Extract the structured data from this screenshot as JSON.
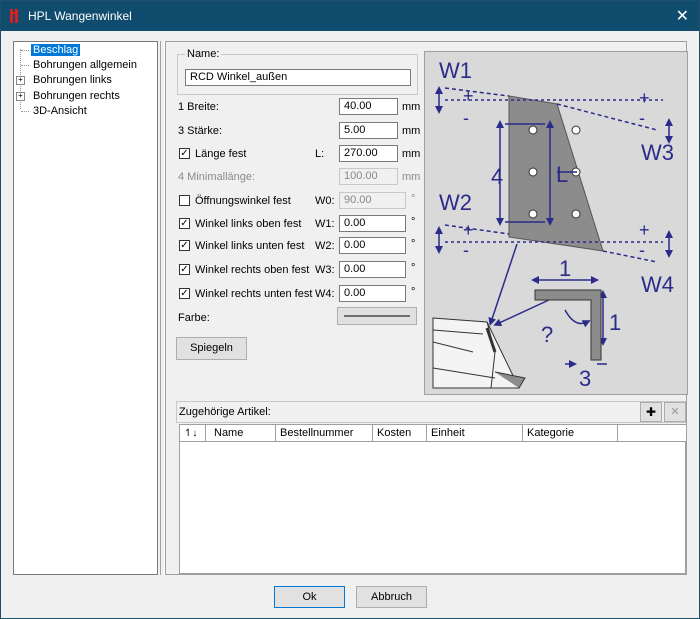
{
  "window": {
    "title": "HPL Wangenwinkel",
    "close_glyph": "✕"
  },
  "tree": {
    "items": [
      {
        "label": "Beschlag"
      },
      {
        "label": "Bohrungen allgemein"
      },
      {
        "label": "Bohrungen links"
      },
      {
        "label": "Bohrungen rechts"
      },
      {
        "label": "3D-Ansicht"
      }
    ]
  },
  "form": {
    "name_group": "Name:",
    "name_value": "RCD Winkel_außen",
    "breite_label": "1 Breite:",
    "breite_value": "40.00",
    "staerke_label": "3 Stärke:",
    "staerke_value": "5.00",
    "laenge_fest_label": "Länge fest",
    "laenge_fest_checked": true,
    "l_label": "L:",
    "l_value": "270.00",
    "minimallaenge_label": "4 Minimallänge:",
    "minimallaenge_value": "100.00",
    "oeffnungswinkel_label": "Öffnungswinkel fest",
    "oeffnungswinkel_checked": false,
    "w0_label": "W0:",
    "w0_value": "90.00",
    "wlo_label": "Winkel links oben fest",
    "wlo_checked": true,
    "w1_label": "W1:",
    "w1_value": "0.00",
    "wlu_label": "Winkel links unten fest",
    "wlu_checked": true,
    "w2_label": "W2:",
    "w2_value": "0.00",
    "wro_label": "Winkel rechts oben fest",
    "wro_checked": true,
    "w3_label": "W3:",
    "w3_value": "0.00",
    "wru_label": "Winkel rechts unten fest",
    "wru_checked": true,
    "w4_label": "W4:",
    "w4_value": "0.00",
    "unit_mm": "mm",
    "unit_deg": "°",
    "farbe_label": "Farbe:",
    "spiegeln_label": "Spiegeln",
    "check_glyph": "✓"
  },
  "diagram": {
    "labels": {
      "w1": "W1",
      "w2": "W2",
      "w3": "W3",
      "w4": "W4",
      "four": "4",
      "L": "L",
      "one_top": "1",
      "one_right": "1",
      "three": "3",
      "question": "?",
      "plus": "+",
      "minus": "-"
    }
  },
  "articles": {
    "label": "Zugehörige Artikel:",
    "add_glyph": "✚",
    "remove_glyph": "✕",
    "sort_glyph": "↿↓",
    "columns": [
      "Name",
      "Bestellnummer",
      "Kosten",
      "Einheit",
      "Kategorie"
    ]
  },
  "buttons": {
    "ok": "Ok",
    "cancel": "Abbruch"
  }
}
